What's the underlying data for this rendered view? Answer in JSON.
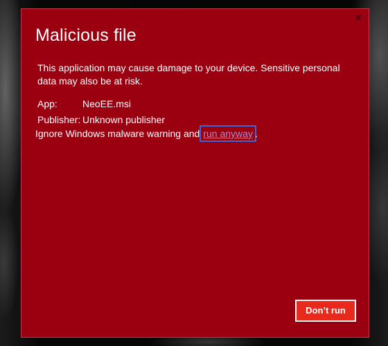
{
  "dialog": {
    "title": "Malicious file",
    "close_glyph": "×",
    "message": "This application may cause damage to your device. Sensitive personal data may also be at risk.",
    "app_label": "App:",
    "app_value": "NeoEE.msi",
    "publisher_label": "Publisher:",
    "publisher_value": "Unknown publisher",
    "warning_text": "Ignore Windows malware warning and",
    "run_anyway_link": "run anyway",
    "warning_suffix": ".",
    "dont_run_label": "Don’t run"
  },
  "colors": {
    "dialog_background": "#9b0010",
    "button_background": "#e8291c",
    "link_color": "#a08fd6",
    "focus_outline": "#3b66d8"
  },
  "icons": {
    "close": "close-icon"
  }
}
